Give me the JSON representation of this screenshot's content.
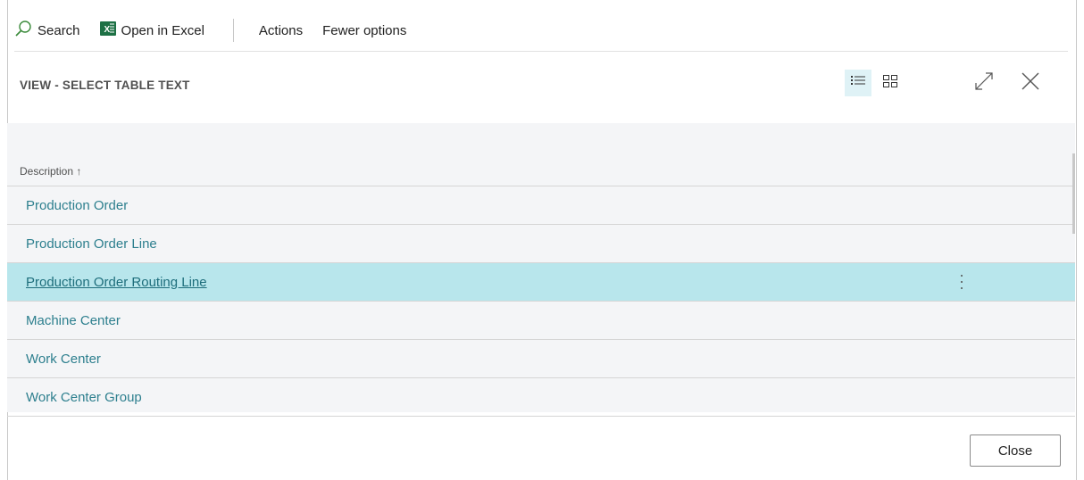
{
  "actionbar": {
    "search_label": "Search",
    "excel_label": "Open in Excel",
    "actions_label": "Actions",
    "fewer_options_label": "Fewer options"
  },
  "header": {
    "title": "VIEW - SELECT TABLE TEXT"
  },
  "grid": {
    "column_header": "Description",
    "sort_indicator": "↑",
    "rows": [
      "Production Order",
      "Production Order Line",
      "Production Order Routing Line",
      "Machine Center",
      "Work Center",
      "Work Center Group"
    ],
    "selected_index": 2
  },
  "footer": {
    "close_label": "Close"
  },
  "colors": {
    "accent": "#2d7f8e",
    "selected_row": "#b8e6ec",
    "grid_bg": "#f4f5f7",
    "excel_green": "#1e7145"
  },
  "icons": [
    "search-icon",
    "excel-icon",
    "list-view-icon",
    "tile-view-icon",
    "expand-icon",
    "close-icon",
    "more-icon"
  ]
}
